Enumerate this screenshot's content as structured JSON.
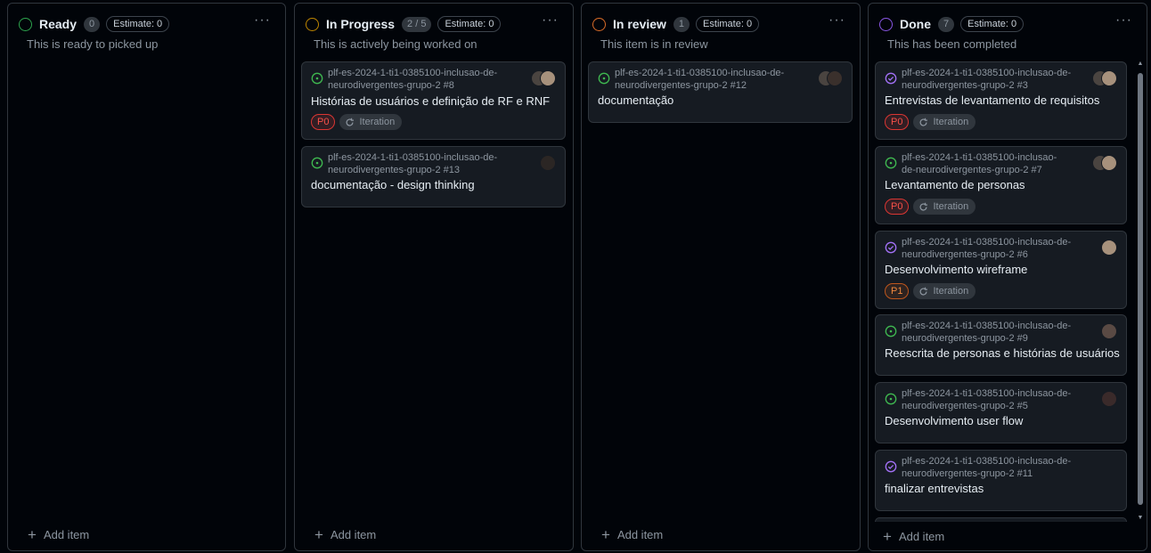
{
  "board": {
    "add_item_label": "Add item",
    "columns": [
      {
        "title": "Ready",
        "status_color": "#2da44e",
        "count": "0",
        "estimate": "Estimate: 0",
        "description": "This is ready to picked up",
        "cards": []
      },
      {
        "title": "In Progress",
        "status_color": "#bf8700",
        "count": "2 / 5",
        "estimate": "Estimate: 0",
        "description": "This is actively being worked on",
        "cards": [
          {
            "ref_line1": "plf-es-2024-1-ti1-0385100-inclusao-de-",
            "ref_line2": "neurodivergentes-grupo-2 #8",
            "title": "Histórias de usuários e definição de RF e RNF",
            "state": "open",
            "labels": [
              "P0"
            ],
            "iteration": "Iteration"
          },
          {
            "ref_line1": "plf-es-2024-1-ti1-0385100-inclusao-de-",
            "ref_line2": "neurodivergentes-grupo-2 #13",
            "title": "documentação - design thinking",
            "state": "open",
            "labels": [],
            "iteration": ""
          }
        ]
      },
      {
        "title": "In review",
        "status_color": "#db6d28",
        "count": "1",
        "estimate": "Estimate: 0",
        "description": "This item is in review",
        "cards": [
          {
            "ref_line1": "plf-es-2024-1-ti1-0385100-inclusao-de-",
            "ref_line2": "neurodivergentes-grupo-2 #12",
            "title": "documentação",
            "state": "open",
            "labels": [],
            "iteration": ""
          }
        ]
      },
      {
        "title": "Done",
        "status_color": "#8957e5",
        "count": "7",
        "estimate": "Estimate: 0",
        "description": "This has been completed",
        "cards": [
          {
            "ref_line1": "plf-es-2024-1-ti1-0385100-inclusao-de-",
            "ref_line2": "neurodivergentes-grupo-2 #3",
            "title": "Entrevistas de levantamento de requisitos",
            "state": "closed",
            "labels": [
              "P0"
            ],
            "iteration": "Iteration"
          },
          {
            "ref_line1": "plf-es-2024-1-ti1-0385100-inclusao-",
            "ref_line2": "de-neurodivergentes-grupo-2 #7",
            "title": "Levantamento de personas",
            "state": "open",
            "labels": [
              "P0"
            ],
            "iteration": "Iteration"
          },
          {
            "ref_line1": "plf-es-2024-1-ti1-0385100-inclusao-de-",
            "ref_line2": "neurodivergentes-grupo-2 #6",
            "title": "Desenvolvimento wireframe",
            "state": "closed",
            "labels": [
              "P1"
            ],
            "iteration": "Iteration"
          },
          {
            "ref_line1": "plf-es-2024-1-ti1-0385100-inclusao-de-",
            "ref_line2": "neurodivergentes-grupo-2 #9",
            "title": "Reescrita de personas e histórias de usuários",
            "state": "open",
            "labels": [],
            "iteration": ""
          },
          {
            "ref_line1": "plf-es-2024-1-ti1-0385100-inclusao-de-",
            "ref_line2": "neurodivergentes-grupo-2 #5",
            "title": "Desenvolvimento user flow",
            "state": "open",
            "labels": [],
            "iteration": ""
          },
          {
            "ref_line1": "plf-es-2024-1-ti1-0385100-inclusao-de-",
            "ref_line2": "neurodivergentes-grupo-2 #11",
            "title": "finalizar entrevistas",
            "state": "closed",
            "labels": [],
            "iteration": ""
          }
        ]
      }
    ]
  },
  "colors": {
    "open_issue": "#3fb950",
    "closed_issue": "#a371f7"
  },
  "more_icon_glyph": "···"
}
